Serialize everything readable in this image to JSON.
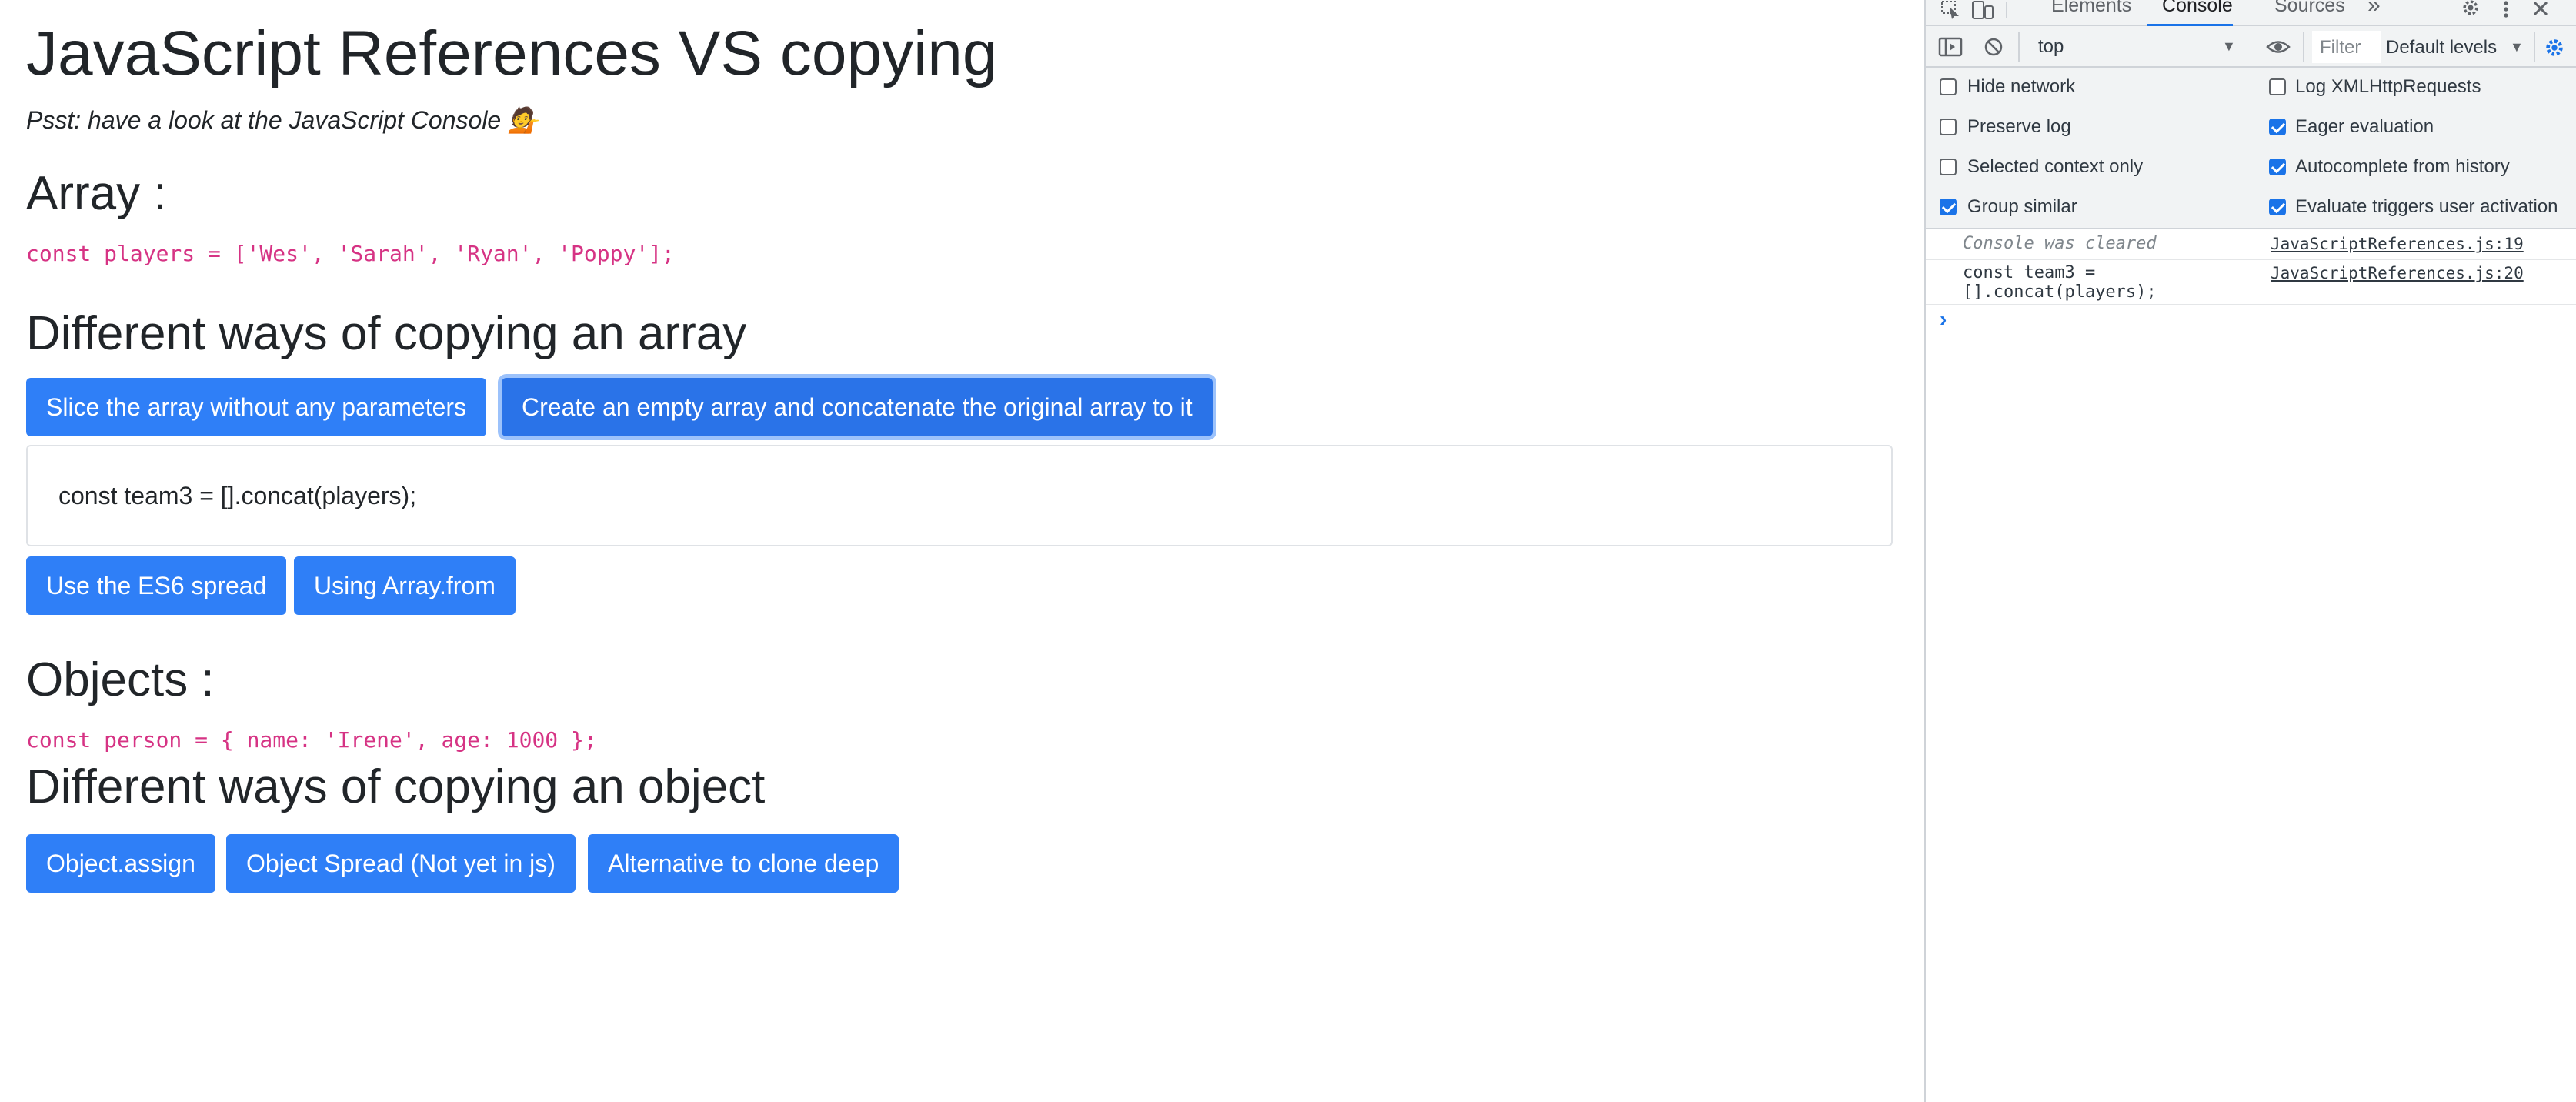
{
  "page": {
    "title": "JavaScript References VS copying",
    "lead": "Psst: have a look at the JavaScript Console 💁",
    "array_heading": "Array :",
    "array_code": "const players = ['Wes', 'Sarah', 'Ryan', 'Poppy'];",
    "array_copy_heading": "Different ways of copying an array",
    "array_buttons": [
      "Slice the array without any parameters",
      "Create an empty array and concatenate the original array to it",
      "Use the ES6 spread",
      "Using Array.from"
    ],
    "output_text": "const team3 = [].concat(players);",
    "objects_heading": "Objects :",
    "object_code": "const person = { name: 'Irene', age: 1000 };",
    "object_copy_heading": "Different ways of copying an object",
    "object_buttons": [
      "Object.assign",
      "Object Spread (Not yet in js)",
      "Alternative to clone deep"
    ]
  },
  "devtools": {
    "tabs": [
      "Elements",
      "Console",
      "Sources"
    ],
    "active_tab": "Console",
    "more_tabs": "»",
    "context": "top",
    "filter_placeholder": "Filter",
    "levels": "Default levels",
    "settings": {
      "left": [
        {
          "label": "Hide network",
          "checked": false
        },
        {
          "label": "Preserve log",
          "checked": false
        },
        {
          "label": "Selected context only",
          "checked": false
        },
        {
          "label": "Group similar",
          "checked": true
        }
      ],
      "right": [
        {
          "label": "Log XMLHttpRequests",
          "checked": false
        },
        {
          "label": "Eager evaluation",
          "checked": true
        },
        {
          "label": "Autocomplete from history",
          "checked": true
        },
        {
          "label": "Evaluate triggers user activation",
          "checked": true
        }
      ]
    },
    "log": [
      {
        "message": "Console was cleared",
        "source": "JavaScriptReferences.js:19"
      },
      {
        "message_line1": "const team3 =",
        "message_line2": "[].concat(players);",
        "source": "JavaScriptReferences.js:20"
      }
    ],
    "prompt": "›",
    "colors": {
      "accent": "#1a73e8",
      "button": "#2f7ff7",
      "code": "#d63384"
    }
  }
}
